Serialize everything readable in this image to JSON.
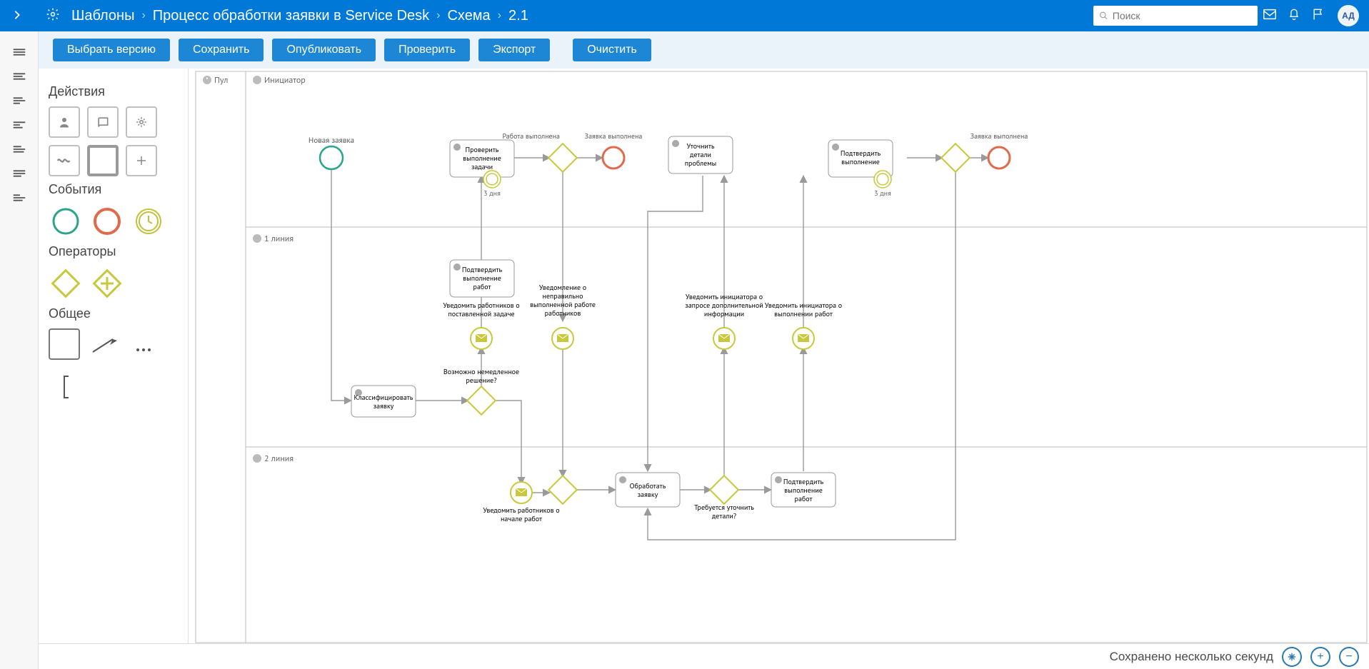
{
  "header": {
    "breadcrumb": [
      "Шаблоны",
      "Процесс обработки заявки в Service Desk",
      "Схема",
      "2.1"
    ],
    "search_placeholder": "Поиск",
    "avatar": "АД"
  },
  "toolbar": {
    "select_version": "Выбрать версию",
    "save": "Сохранить",
    "publish": "Опубликовать",
    "check": "Проверить",
    "export": "Экспорт",
    "clear": "Очистить"
  },
  "palette": {
    "actions_title": "Действия",
    "events_title": "События",
    "operators_title": "Операторы",
    "general_title": "Общее"
  },
  "status": {
    "saved_text": "Сохранено несколько секунд"
  },
  "diagram": {
    "pool_label": "Пул",
    "lanes": {
      "initiator": "Инициатор",
      "line1": "1 линия",
      "line2": "2 линия"
    },
    "nodes": {
      "new_request": "Новая заявка",
      "check_task": [
        "Проверить",
        "выполнение",
        "задачи"
      ],
      "timer1": "3 дня",
      "work_done": "Работа выполнена",
      "request_done": "Заявка выполнена",
      "clarify_details": [
        "Уточнить",
        "детали",
        "проблемы"
      ],
      "confirm_exec1": [
        "Подтвердить",
        "выполнение"
      ],
      "timer2": "3 дня",
      "request_done2": "Заявка выполнена",
      "confirm_work_line1": [
        "Подтвердить",
        "выполнение",
        "работ"
      ],
      "notify_task_set": [
        "Уведомить работников о",
        "поставленной задаче"
      ],
      "notify_wrong_work": [
        "Уведомление о",
        "неправильно",
        "выполненной работе",
        "работников"
      ],
      "notify_extra_info": [
        "Уведомить инициатора о",
        "запросе дополнительной",
        "информации"
      ],
      "notify_done": [
        "Уведомить инициатора о",
        "выполнении работ"
      ],
      "classify": [
        "Классифицировать",
        "заявку"
      ],
      "gw_immediate": [
        "Возможно немедленное",
        "решение?"
      ],
      "notify_start": [
        "Уведомить работников о",
        "начале работ"
      ],
      "process_request": [
        "Обработать",
        "заявку"
      ],
      "gw_need_clarify": [
        "Требуется уточнить",
        "детали?"
      ],
      "confirm_work_line2": [
        "Подтвердить",
        "выполнение",
        "работ"
      ]
    }
  }
}
